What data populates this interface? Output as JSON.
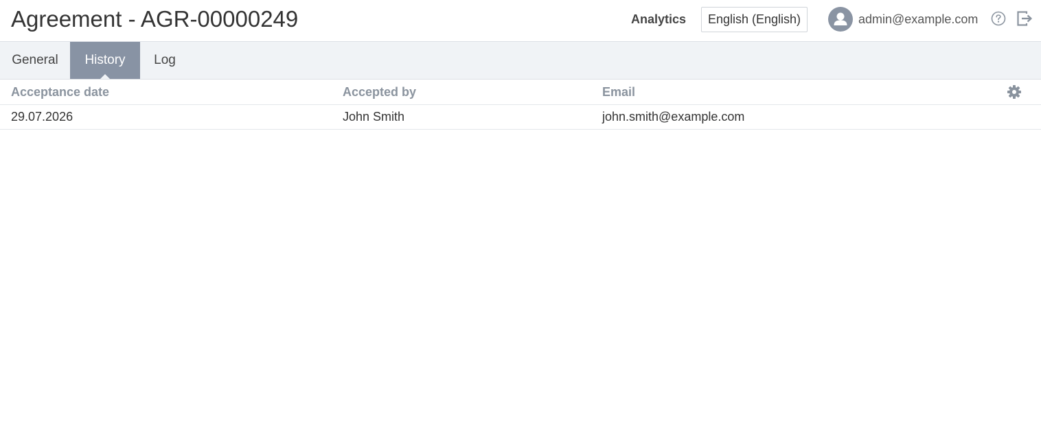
{
  "header": {
    "title": "Agreement - AGR-00000249",
    "analytics_label": "Analytics",
    "language_selected": "English (English)",
    "user_email": "admin@example.com",
    "icons": {
      "avatar": "user-avatar-icon",
      "help": "help-icon",
      "logout": "logout-icon"
    }
  },
  "tabs": [
    {
      "label": "General",
      "active": false
    },
    {
      "label": "History",
      "active": true
    },
    {
      "label": "Log",
      "active": false
    }
  ],
  "grid": {
    "columns": [
      "Acceptance date",
      "Accepted by",
      "Email"
    ],
    "settings_icon": "gear-icon",
    "rows": [
      {
        "acceptance_date": "29.07.2026",
        "accepted_by": "John Smith",
        "email": "john.smith@example.com"
      }
    ]
  },
  "colors": {
    "active_tab_bg": "#8893a4",
    "tab_bar_bg": "#f0f3f6",
    "column_header_text": "#8a939e",
    "avatar_bg": "#8a94a3"
  }
}
